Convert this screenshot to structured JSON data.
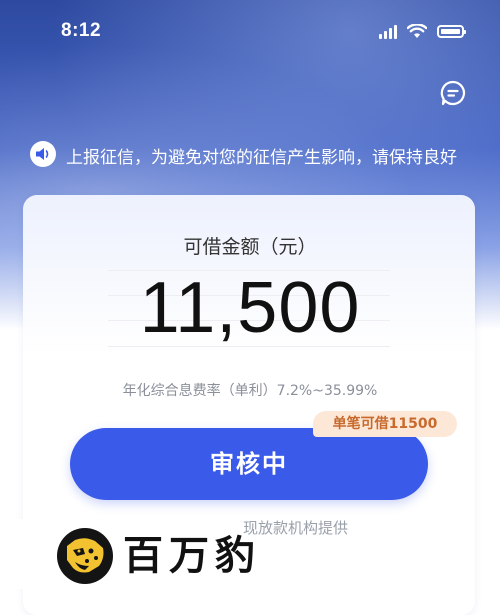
{
  "status_bar": {
    "time": "8:12"
  },
  "notice": {
    "text": "上报征信，为避免对您的征信产生影响，请保持良好"
  },
  "loan": {
    "amount_label": "可借金额（元）",
    "amount": "11,500",
    "rate_text": "年化综合息费率（单利）7.2%~35.99%",
    "single_limit_badge": "单笔可借11500",
    "review_button_label": "审核中",
    "provider_text": "现放款机构提供"
  },
  "watermark": {
    "brand_text": "百万豹"
  },
  "colors": {
    "primary_button": "#3a5ae9",
    "badge_bg": "#fde8d7",
    "badge_text": "#c86a2d"
  }
}
